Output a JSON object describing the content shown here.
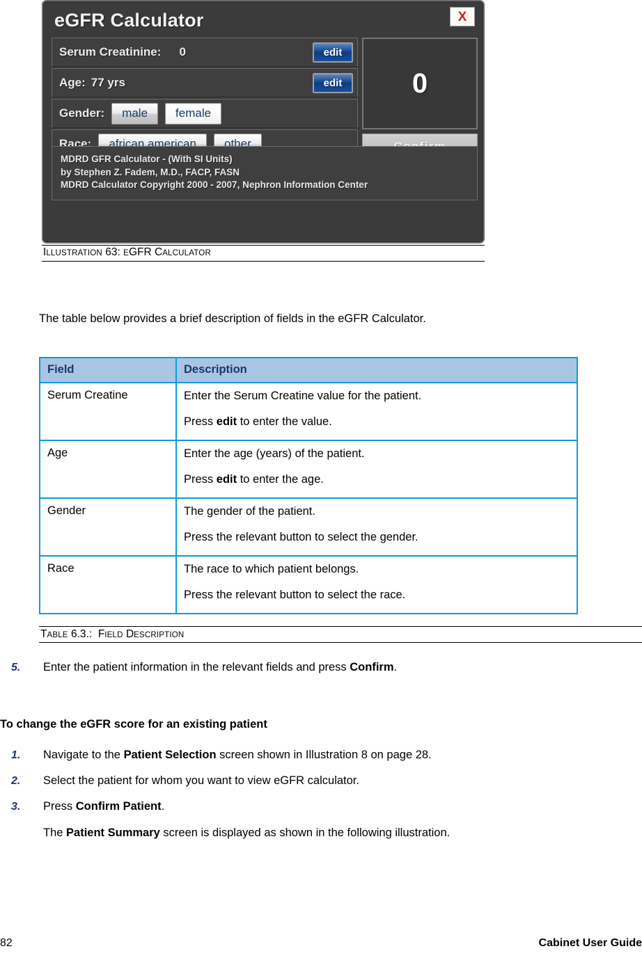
{
  "illustration": {
    "app": {
      "title": "eGFR Calculator",
      "close_label": "X",
      "fields": [
        {
          "label": "Serum Creatinine:",
          "value": "0",
          "action_label": "edit"
        },
        {
          "label": "Age:",
          "value": "77 yrs",
          "action_label": "edit"
        }
      ],
      "gender": {
        "label": "Gender:",
        "options": [
          "male",
          "female"
        ]
      },
      "race": {
        "label": "Race:",
        "options": [
          "african american",
          "other"
        ]
      },
      "result_value": "0",
      "confirm_label": "Confirm",
      "note_lines": [
        "MDRD GFR Calculator - (With SI Units)",
        "by Stephen Z. Fadem, M.D., FACP, FASN",
        "MDRD Calculator Copyright 2000 - 2007, Nephron Information Center"
      ]
    },
    "caption": {
      "prefix": "I",
      "prefix_rest": "LLUSTRATION",
      "number": "63",
      "separator": ":",
      "title_lead": "E",
      "title_big": "GFR C",
      "title_rest": "ALCULATOR"
    }
  },
  "intro_paragraph": "The table below provides a brief description of fields in the eGFR Calculator.",
  "table": {
    "columns": [
      "Field",
      "Description"
    ],
    "rows": [
      {
        "field": "Serum Creatine",
        "desc_line1": "Enter the Serum Creatine value for the patient.",
        "desc_line2_pre": "Press ",
        "desc_line2_bold": "edit",
        "desc_line2_post": " to enter the value."
      },
      {
        "field": "Age",
        "desc_line1": "Enter the age (years) of the patient.",
        "desc_line2_pre": "Press ",
        "desc_line2_bold": "edit",
        "desc_line2_post": " to enter the age."
      },
      {
        "field": "Gender",
        "desc_line1": "The gender of the patient.",
        "desc_line2_pre": "Press the relevant button to select the gender.",
        "desc_line2_bold": "",
        "desc_line2_post": ""
      },
      {
        "field": "Race",
        "desc_line1": "The race to which patient belongs.",
        "desc_line2_pre": "Press the relevant button to select the race.",
        "desc_line2_bold": "",
        "desc_line2_post": ""
      }
    ],
    "caption": {
      "prefix": "T",
      "prefix_rest": "ABLE",
      "number": "6.3",
      "separator": ".:",
      "title_lead": "F",
      "title_rest": "IELD",
      "title_lead2": " D",
      "title_rest2": "ESCRIPTION"
    }
  },
  "step5": {
    "num": "5.",
    "text_pre": "Enter the patient information in the relevant fields and press ",
    "text_bold": " Confirm",
    "text_post": "."
  },
  "section_heading": "To change the eGFR score for an existing patient",
  "steps": [
    {
      "num": "1.",
      "pre": "Navigate to the ",
      "bold": "Patient Selection",
      "post": " screen shown in Illustration 8 on page 28."
    },
    {
      "num": "2.",
      "pre": "Select the patient for whom you want to view  eGFR calculator.",
      "bold": "",
      "post": ""
    },
    {
      "num": "3.",
      "pre": "Press ",
      "bold": "Confirm Patient",
      "post": "."
    }
  ],
  "closing_paragraph": {
    "pre": "The ",
    "bold": "Patient Summary",
    "post": " screen is displayed as shown in the following illustration."
  },
  "footer": {
    "page_number": "82",
    "guide_title": "Cabinet User Guide"
  },
  "colors": {
    "table_border": "#0d9bda",
    "table_header_fill": "#a9c5e3",
    "table_header_text": "#1b3a63",
    "step_number": "#1f3864",
    "calc_panel": "#3b3b3b",
    "edit_button": "#1a4f9c",
    "close_x": "#d21f1f"
  }
}
